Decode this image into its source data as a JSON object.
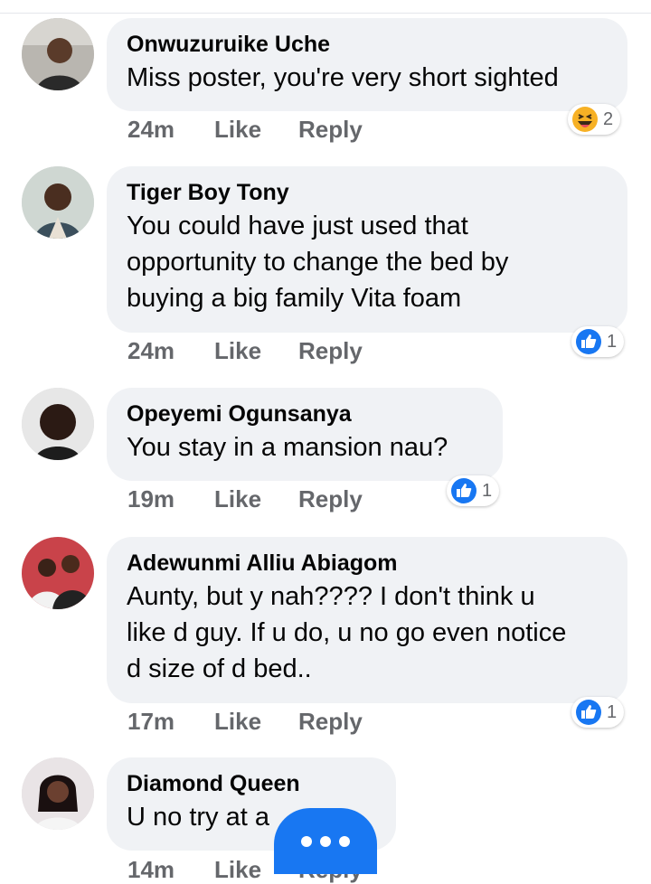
{
  "comments": [
    {
      "name": "Onwuzuruike Uche",
      "text": "Miss poster, you're very short sighted",
      "time": "24m",
      "like": "Like",
      "reply": "Reply",
      "reaction": {
        "icon": "haha-emoji-icon",
        "count": "2"
      }
    },
    {
      "name": "Tiger Boy Tony",
      "text": "You could have just used that\nopportunity to change the bed by\nbuying a big family Vita foam",
      "time": "24m",
      "like": "Like",
      "reply": "Reply",
      "reaction": {
        "icon": "like-thumb-icon",
        "count": "1"
      }
    },
    {
      "name": "Opeyemi Ogunsanya",
      "text": "You stay in a mansion nau?",
      "time": "19m",
      "like": "Like",
      "reply": "Reply",
      "reaction": {
        "icon": "like-thumb-icon",
        "count": "1"
      }
    },
    {
      "name": "Adewunmi Alliu Abiagom",
      "text": "Aunty, but y nah???? I don't think u\nlike d guy. If u do, u no go even notice\nd size of d bed..",
      "time": "17m",
      "like": "Like",
      "reply": "Reply",
      "reaction": {
        "icon": "like-thumb-icon",
        "count": "1"
      }
    },
    {
      "name": "Diamond Queen",
      "text": "U no try at a",
      "time": "14m",
      "like": "Like",
      "reply": "Reply"
    }
  ],
  "fab": {
    "icon": "more-dots-icon"
  },
  "colors": {
    "accent": "#1877f2",
    "bubble": "#f0f2f5",
    "meta": "#65676b"
  }
}
